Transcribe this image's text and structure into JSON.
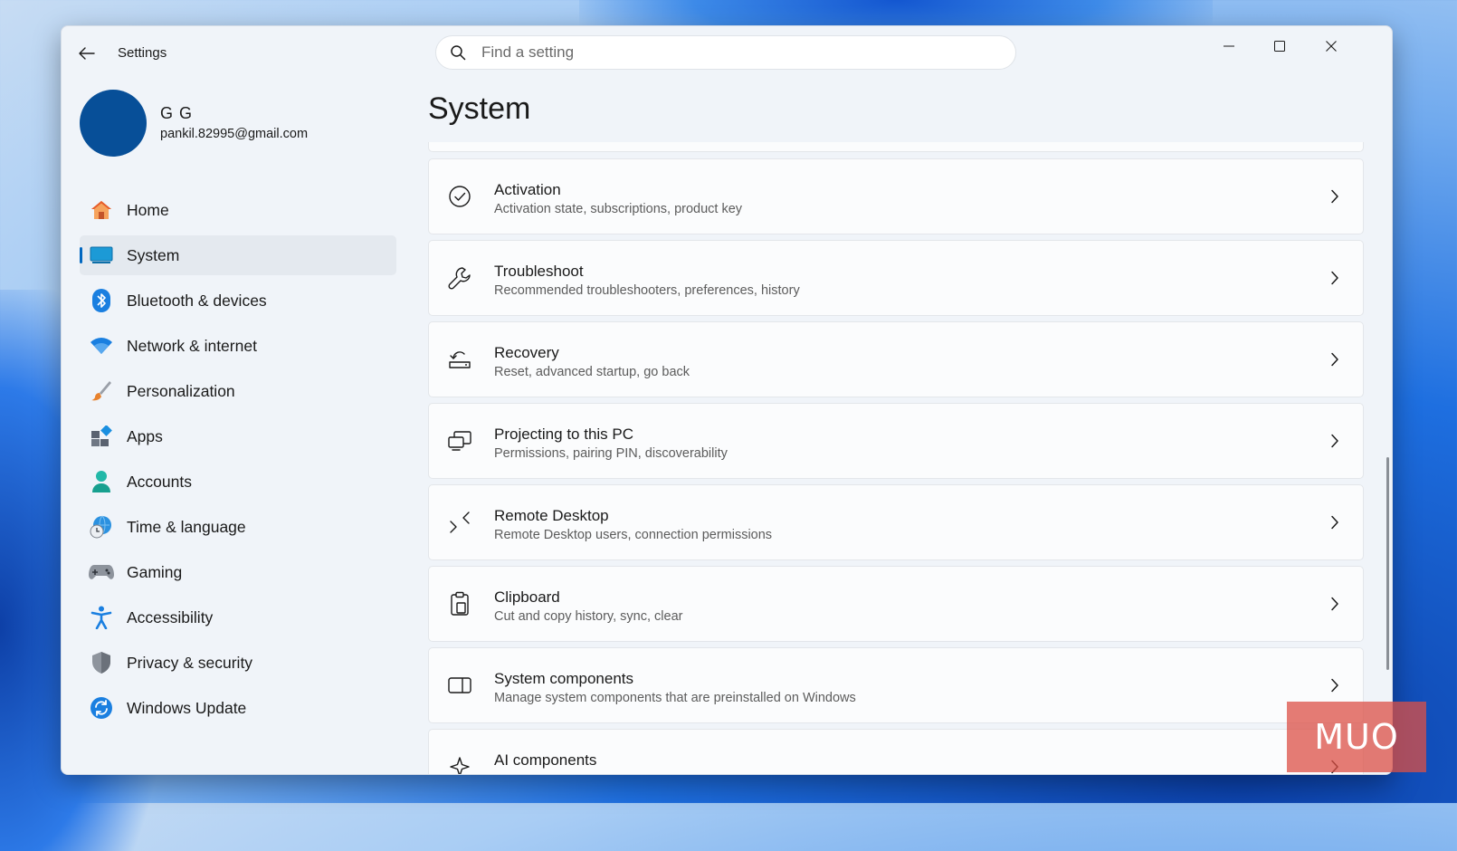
{
  "window": {
    "title": "Settings"
  },
  "search": {
    "placeholder": "Find a setting"
  },
  "profile": {
    "name": "G G",
    "email": "pankil.82995@gmail.com",
    "avatar_color": "#074f98"
  },
  "nav": {
    "items": [
      {
        "label": "Home",
        "icon": "home-icon",
        "active": false
      },
      {
        "label": "System",
        "icon": "system-icon",
        "active": true
      },
      {
        "label": "Bluetooth & devices",
        "icon": "bluetooth-icon",
        "active": false
      },
      {
        "label": "Network & internet",
        "icon": "wifi-icon",
        "active": false
      },
      {
        "label": "Personalization",
        "icon": "brush-icon",
        "active": false
      },
      {
        "label": "Apps",
        "icon": "apps-icon",
        "active": false
      },
      {
        "label": "Accounts",
        "icon": "accounts-icon",
        "active": false
      },
      {
        "label": "Time & language",
        "icon": "globe-clock-icon",
        "active": false
      },
      {
        "label": "Gaming",
        "icon": "gamepad-icon",
        "active": false
      },
      {
        "label": "Accessibility",
        "icon": "accessibility-icon",
        "active": false
      },
      {
        "label": "Privacy & security",
        "icon": "shield-icon",
        "active": false
      },
      {
        "label": "Windows Update",
        "icon": "update-icon",
        "active": false
      }
    ]
  },
  "main": {
    "title": "System",
    "cards": [
      {
        "title": "Activation",
        "desc": "Activation state, subscriptions, product key",
        "icon": "check-circle-icon"
      },
      {
        "title": "Troubleshoot",
        "desc": "Recommended troubleshooters, preferences, history",
        "icon": "wrench-icon"
      },
      {
        "title": "Recovery",
        "desc": "Reset, advanced startup, go back",
        "icon": "recovery-icon"
      },
      {
        "title": "Projecting to this PC",
        "desc": "Permissions, pairing PIN, discoverability",
        "icon": "projecting-icon"
      },
      {
        "title": "Remote Desktop",
        "desc": "Remote Desktop users, connection permissions",
        "icon": "remote-desktop-icon"
      },
      {
        "title": "Clipboard",
        "desc": "Cut and copy history, sync, clear",
        "icon": "clipboard-icon"
      },
      {
        "title": "System components",
        "desc": "Manage system components that are preinstalled on Windows",
        "icon": "system-components-icon"
      },
      {
        "title": "AI components",
        "desc": "",
        "icon": "sparkle-icon"
      }
    ]
  },
  "watermark": {
    "text": "MUO"
  },
  "colors": {
    "accent": "#0067c0",
    "window_bg": "#f0f4f9",
    "card_bg": "#fbfcfd"
  }
}
